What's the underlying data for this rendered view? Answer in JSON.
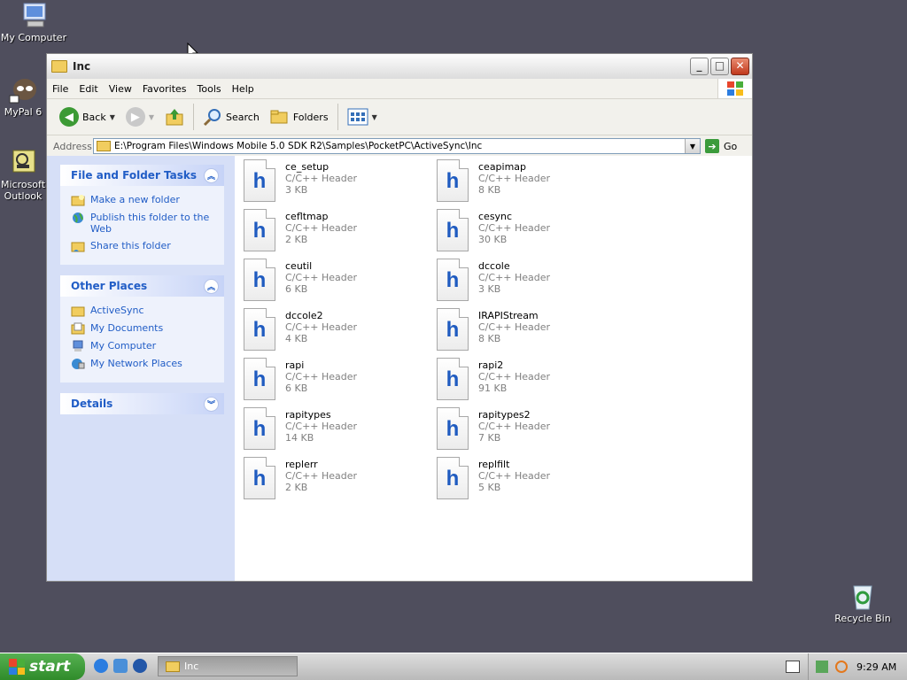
{
  "desktop": {
    "icons": [
      {
        "label": "My Computer"
      },
      {
        "label": "MyPal 6"
      },
      {
        "label": "Microsoft Outlook"
      },
      {
        "label": "Recycle Bin"
      }
    ]
  },
  "window": {
    "title": "Inc",
    "menu": [
      "File",
      "Edit",
      "View",
      "Favorites",
      "Tools",
      "Help"
    ],
    "toolbar": {
      "back": "Back",
      "search": "Search",
      "folders": "Folders"
    },
    "address": {
      "label": "Address",
      "value": "E:\\Program Files\\Windows Mobile 5.0 SDK R2\\Samples\\PocketPC\\ActiveSync\\Inc",
      "go": "Go"
    },
    "tasks": {
      "file_folder": {
        "title": "File and Folder Tasks",
        "items": [
          "Make a new folder",
          "Publish this folder to the Web",
          "Share this folder"
        ]
      },
      "other_places": {
        "title": "Other Places",
        "items": [
          "ActiveSync",
          "My Documents",
          "My Computer",
          "My Network Places"
        ]
      },
      "details": {
        "title": "Details"
      }
    },
    "files": [
      {
        "name": "ce_setup",
        "type": "C/C++ Header",
        "size": "3 KB"
      },
      {
        "name": "ceapimap",
        "type": "C/C++ Header",
        "size": "8 KB"
      },
      {
        "name": "cefltmap",
        "type": "C/C++ Header",
        "size": "2 KB"
      },
      {
        "name": "cesync",
        "type": "C/C++ Header",
        "size": "30 KB"
      },
      {
        "name": "ceutil",
        "type": "C/C++ Header",
        "size": "6 KB"
      },
      {
        "name": "dccole",
        "type": "C/C++ Header",
        "size": "3 KB"
      },
      {
        "name": "dccole2",
        "type": "C/C++ Header",
        "size": "4 KB"
      },
      {
        "name": "IRAPIStream",
        "type": "C/C++ Header",
        "size": "8 KB"
      },
      {
        "name": "rapi",
        "type": "C/C++ Header",
        "size": "6 KB"
      },
      {
        "name": "rapi2",
        "type": "C/C++ Header",
        "size": "91 KB"
      },
      {
        "name": "rapitypes",
        "type": "C/C++ Header",
        "size": "14 KB"
      },
      {
        "name": "rapitypes2",
        "type": "C/C++ Header",
        "size": "7 KB"
      },
      {
        "name": "replerr",
        "type": "C/C++ Header",
        "size": "2 KB"
      },
      {
        "name": "replfilt",
        "type": "C/C++ Header",
        "size": "5 KB"
      }
    ],
    "file_icon_letter": "h"
  },
  "taskbar": {
    "start": "start",
    "task_label": "Inc",
    "clock": "9:29 AM"
  },
  "colors": {
    "desktop": "#4f4e5d",
    "link": "#215dc6",
    "start_green": "#3f9d3a"
  }
}
